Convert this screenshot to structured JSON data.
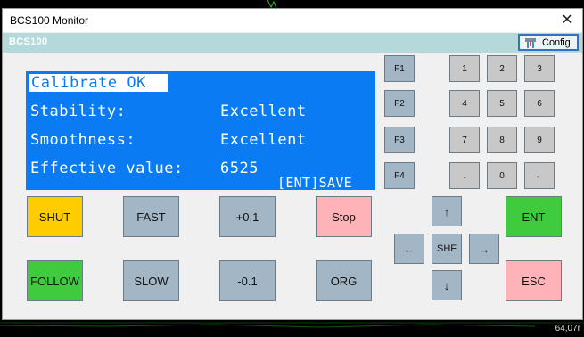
{
  "window": {
    "title": "BCS100 Monitor",
    "close_glyph": "✕"
  },
  "header": {
    "label": "BCS100",
    "config_label": "Config",
    "config_icon": "config-tool-icon"
  },
  "lcd": {
    "line1": "Calibrate OK",
    "line2_label": "Stability:",
    "line2_value": "Excellent",
    "line3_label": "Smoothness:",
    "line3_value": "Excellent",
    "line4_label": "Effective value:",
    "line4_value": "6525",
    "hint": "[ENT]SAVE"
  },
  "function_keys": [
    "F1",
    "F2",
    "F3",
    "F4"
  ],
  "keypad": [
    "1",
    "2",
    "3",
    "4",
    "5",
    "6",
    "7",
    "8",
    "9",
    ".",
    "0",
    "←"
  ],
  "actions": {
    "shut": "SHUT",
    "fast": "FAST",
    "plus": "+0.1",
    "stop": "Stop",
    "follow": "FOLLOW",
    "slow": "SLOW",
    "minus": "-0.1",
    "org": "ORG",
    "ent": "ENT",
    "esc": "ESC"
  },
  "nav": {
    "up": "↑",
    "down": "↓",
    "left": "←",
    "right": "→",
    "shift": "SHF"
  },
  "corner_readout": "64,07r",
  "colors": {
    "lcd_bg": "#0a7bf2",
    "header_bg": "#b5d9da",
    "shut": "#ffcc00",
    "green": "#3ecb3e",
    "pink": "#ffb3b8",
    "gray_button": "#a3b6c6"
  }
}
